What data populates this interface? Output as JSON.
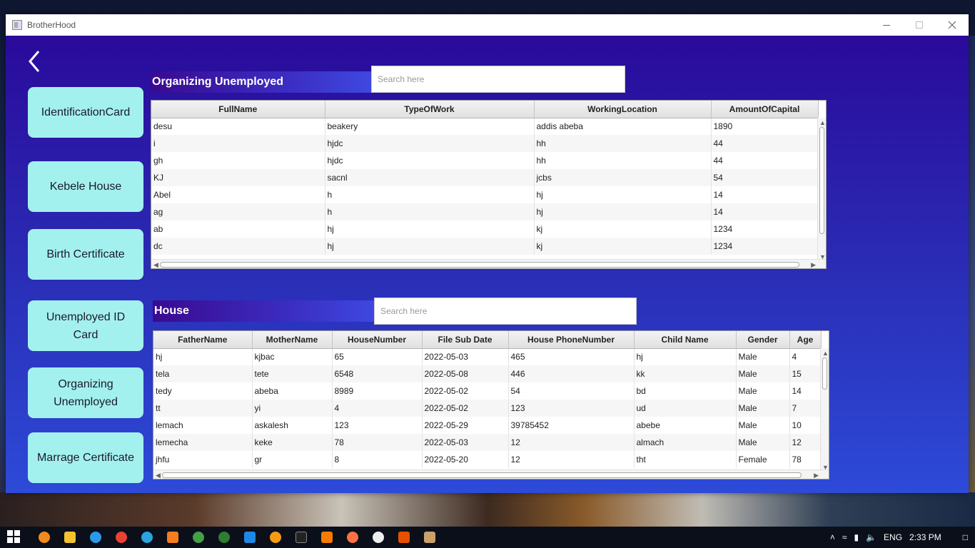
{
  "window": {
    "title": "BrotherHood"
  },
  "sidebar": {
    "items": [
      {
        "label": "IdentificationCard"
      },
      {
        "label": "Kebele House"
      },
      {
        "label": "Birth Certificate"
      },
      {
        "label": "Unemployed ID Card"
      },
      {
        "label": "Organizing Unemployed"
      },
      {
        "label": "Marrage Certificate"
      }
    ]
  },
  "unemployed": {
    "title": "Organizing Unemployed",
    "search_placeholder": "Search here",
    "columns": [
      "FullName",
      "TypeOfWork",
      "WorkingLocation",
      "AmountOfCapital"
    ],
    "rows": [
      [
        "desu",
        "beakery",
        "addis abeba",
        "1890"
      ],
      [
        "i",
        "hjdc",
        "hh",
        "44"
      ],
      [
        "gh",
        "hjdc",
        "hh",
        "44"
      ],
      [
        "KJ",
        "sacnl",
        "jcbs",
        "54"
      ],
      [
        "Abel",
        "h",
        "hj",
        "14"
      ],
      [
        "ag",
        "h",
        "hj",
        "14"
      ],
      [
        "ab",
        "hj",
        "kj",
        "1234"
      ],
      [
        "dc",
        "hj",
        "kj",
        "1234"
      ]
    ]
  },
  "house": {
    "title": "House",
    "search_placeholder": "Search here",
    "columns": [
      "FatherName",
      "MotherName",
      "HouseNumber",
      "File Sub Date",
      "House PhoneNumber",
      "Child Name",
      "Gender",
      "Age"
    ],
    "rows": [
      [
        "hj",
        "kjbac",
        "65",
        "2022-05-03",
        "465",
        "hj",
        "Male",
        "4"
      ],
      [
        "tela",
        "tete",
        "6548",
        "2022-05-08",
        "446",
        "kk",
        "Male",
        "15"
      ],
      [
        "tedy",
        "abeba",
        "8989",
        "2022-05-02",
        "54",
        "bd",
        "Male",
        "14"
      ],
      [
        "tt",
        "yi",
        "4",
        "2022-05-02",
        "123",
        "ud",
        "Male",
        "7"
      ],
      [
        "lemach",
        "askalesh",
        "123",
        "2022-05-29",
        "39785452",
        "abebe",
        "Male",
        "10"
      ],
      [
        "lemecha",
        "keke",
        "78",
        "2022-05-03",
        "12",
        "almach",
        "Male",
        "12"
      ],
      [
        "jhfu",
        "gr",
        "8",
        "2022-05-20",
        "12",
        "tht",
        "Female",
        "78"
      ]
    ]
  },
  "taskbar": {
    "language": "ENG",
    "time": "2:33 PM"
  },
  "colors": {
    "sidebar_button": "#a3f1ef",
    "accent_blue": "#2a2fb8"
  }
}
